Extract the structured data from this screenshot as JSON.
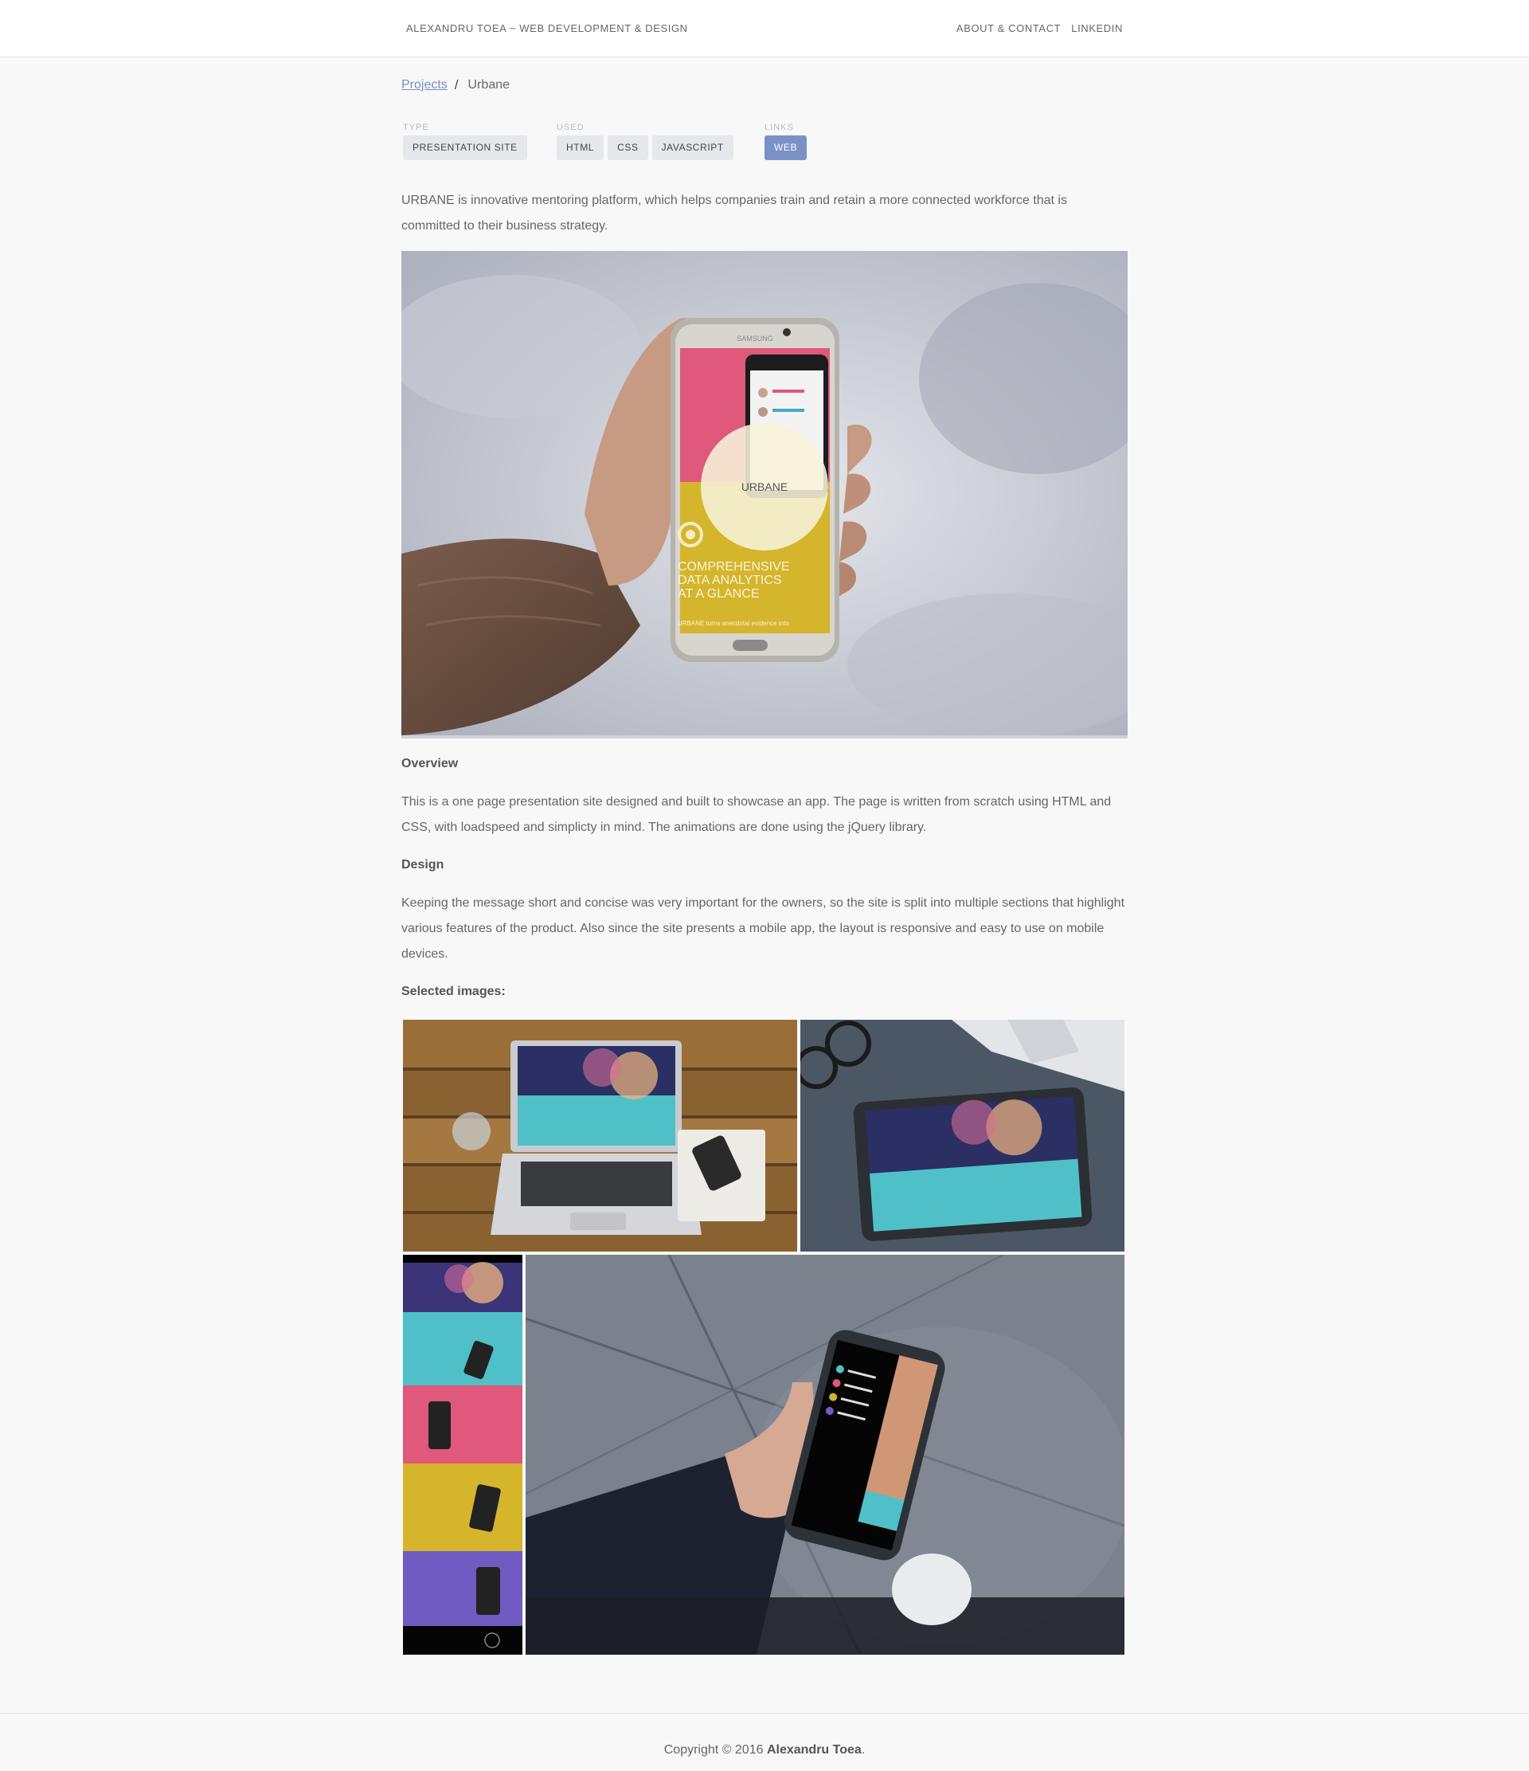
{
  "header": {
    "brand": "ALEXANDRU TOEA ~ WEB DEVELOPMENT & DESIGN",
    "nav": [
      "ABOUT & CONTACT",
      "LINKEDIN"
    ]
  },
  "breadcrumb": {
    "parent": "Projects",
    "separator": "/",
    "current": "Urbane"
  },
  "meta": {
    "type": {
      "label": "TYPE",
      "tags": [
        "PRESENTATION SITE"
      ]
    },
    "used": {
      "label": "USED",
      "tags": [
        "HTML",
        "CSS",
        "JAVASCRIPT"
      ]
    },
    "links": {
      "label": "LINKS",
      "tags": [
        "WEB"
      ]
    }
  },
  "intro": "URBANE is innovative mentoring platform, which helps companies train and retain a more connected workforce that is committed to their business strategy.",
  "hero": {
    "brand_text": "URBANE",
    "headline": [
      "COMPREHENSIVE",
      "DATA ANALYTICS",
      "AT A GLANCE"
    ],
    "subline": "URBANE turns anecdotal evidence into",
    "phone_brand": "SAMSUNG"
  },
  "sections": {
    "overview_title": "Overview",
    "overview_text": "This is a one page presentation site designed and built to showcase an app. The page is written from scratch using HTML and CSS, with loadspeed and simplicty in mind. The animations are done using the jQuery library.",
    "design_title": "Design",
    "design_text": "Keeping the message short and concise was very important for the owners, so the site is split into multiple sections that highlight various features of the product. Also since the site presents a mobile app, the layout is responsive and easy to use on mobile devices.",
    "selected_title": "Selected images:"
  },
  "footer": {
    "prefix": "Copyright © 2016 ",
    "name": "Alexandru Toea",
    "suffix": "."
  },
  "colors": {
    "accent": "#7b90c7",
    "pink": "#e0587c",
    "mustard": "#d5b52c",
    "teal": "#4fc0c8",
    "purple": "#6f5bc2"
  }
}
